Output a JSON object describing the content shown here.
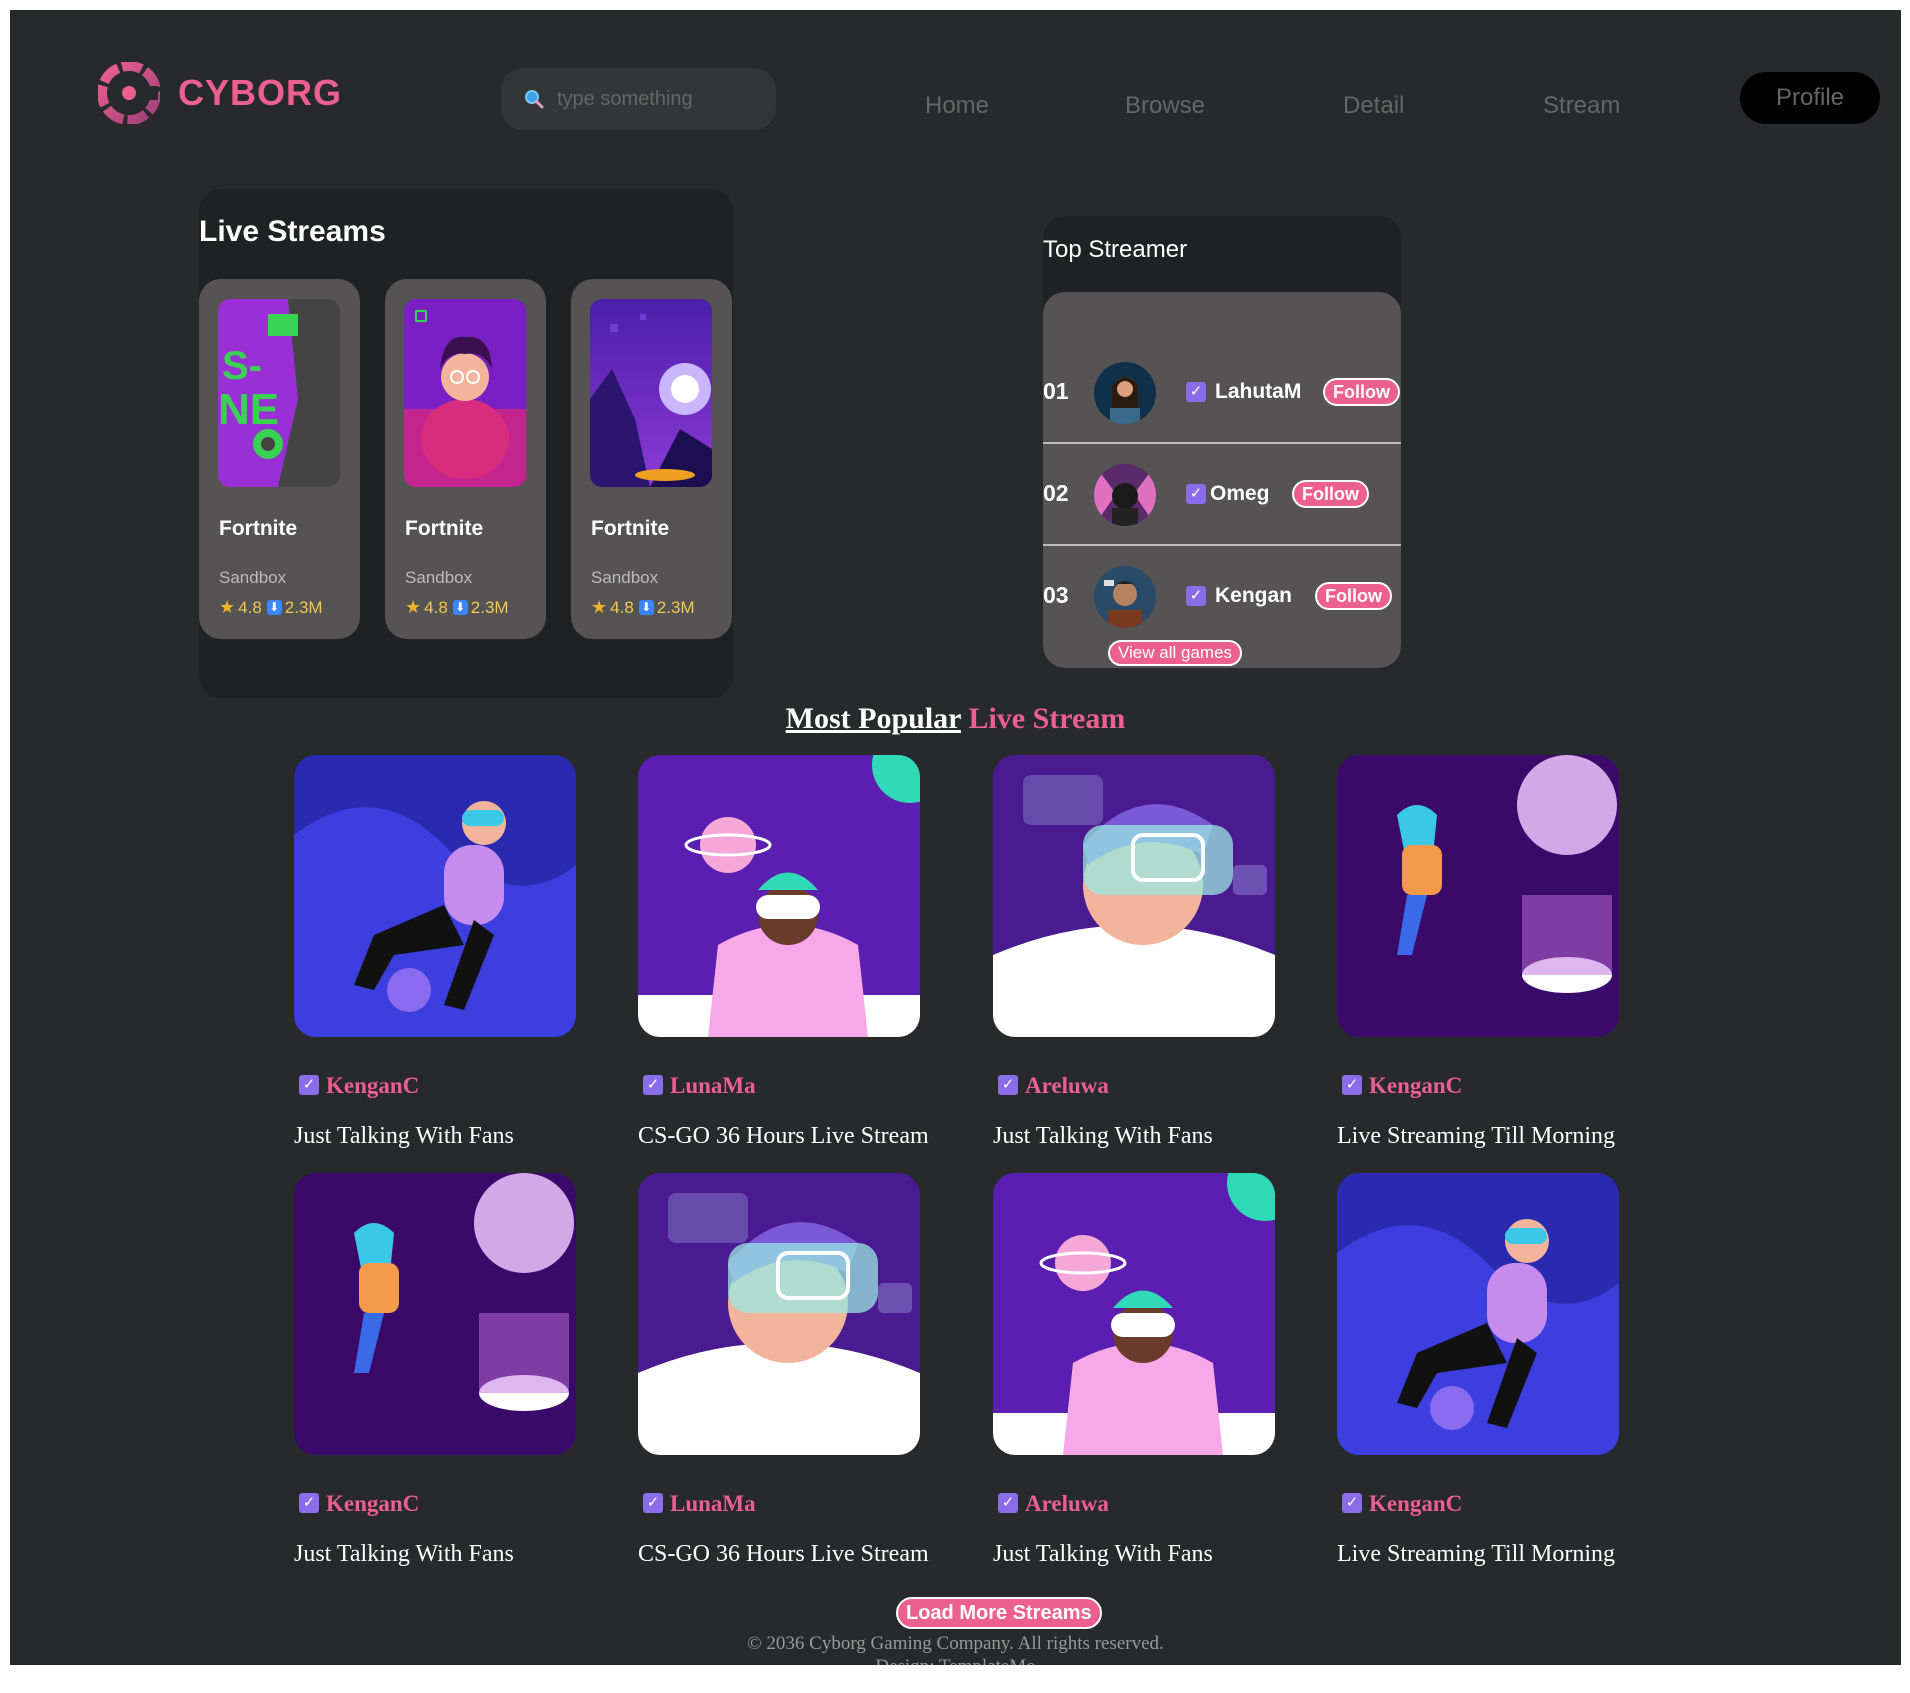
{
  "header": {
    "logo_text": "CYBORG",
    "search_placeholder": "type something",
    "nav": [
      "Home",
      "Browse",
      "Detail",
      "Stream"
    ],
    "profile_label": "Profile"
  },
  "live_streams": {
    "title": "Live Streams",
    "cards": [
      {
        "game": "Fortnite",
        "genre": "Sandbox",
        "rating": "4.8",
        "downloads": "2.3M"
      },
      {
        "game": "Fortnite",
        "genre": "Sandbox",
        "rating": "4.8",
        "downloads": "2.3M"
      },
      {
        "game": "Fortnite",
        "genre": "Sandbox",
        "rating": "4.8",
        "downloads": "2.3M"
      }
    ]
  },
  "top_streamer": {
    "title": "Top Streamer",
    "rows": [
      {
        "rank": "01",
        "name": "LahutaM",
        "follow": "Follow"
      },
      {
        "rank": "02",
        "name": "Omeg",
        "follow": "Follow"
      },
      {
        "rank": "03",
        "name": "Kengan",
        "follow": "Follow"
      }
    ],
    "view_all": "View all games"
  },
  "popular": {
    "heading_part1": "Most Popular",
    "heading_part2": " Live Stream",
    "cards": [
      {
        "streamer": "KenganC",
        "title": "Just Talking With Fans"
      },
      {
        "streamer": "LunaMa",
        "title": "CS-GO 36 Hours Live Stream"
      },
      {
        "streamer": "Areluwa",
        "title": "Just Talking With Fans"
      },
      {
        "streamer": "KenganC",
        "title": "Live Streaming Till Morning"
      },
      {
        "streamer": "KenganC",
        "title": "Just Talking With Fans"
      },
      {
        "streamer": "LunaMa",
        "title": "CS-GO 36 Hours Live Stream"
      },
      {
        "streamer": "Areluwa",
        "title": "Just Talking With Fans"
      },
      {
        "streamer": "KenganC",
        "title": "Live Streaming Till Morning"
      }
    ],
    "load_more": "Load More Streams"
  },
  "footer": {
    "copyright": "© 2036 Cyborg Gaming Company. All rights reserved.",
    "design": "Design: TemplateMo"
  },
  "colors": {
    "accent": "#ec6090",
    "background": "#27292a",
    "panel": "#1f2122",
    "card": "#555353",
    "verify": "#8a6de8"
  },
  "icons": [
    "cyborg-logo-icon",
    "search-icon",
    "star-icon",
    "download-icon",
    "verified-check-icon"
  ]
}
